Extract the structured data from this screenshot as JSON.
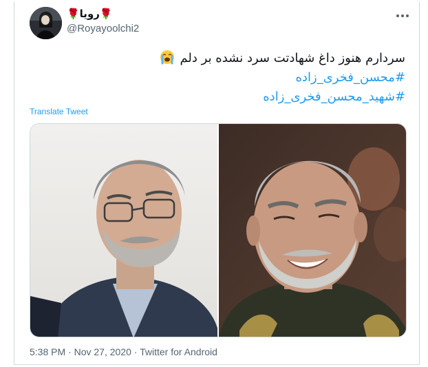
{
  "author": {
    "display_name": "🌹رویا🌹",
    "handle": "@Royayoolchi2"
  },
  "tweet": {
    "line1": "سردارم هنوز داغ شهادتت سرد نشده بر دلم",
    "line1_emoji": "loudly-crying-face-emoji",
    "hashtag1": "#محسن_فخری_زاده",
    "hashtag2": "#شهید_محسن_فخری_زاده"
  },
  "translate_label": "Translate Tweet",
  "media": {
    "photo_left": "photo-elderly-man-glasses",
    "photo_right": "photo-smiling-man-uniform"
  },
  "meta": {
    "time": "5:38 PM",
    "separator": "·",
    "date": "Nov 27, 2020",
    "source": "Twitter for Android"
  },
  "colors": {
    "link": "#1d9bf0",
    "secondary_text": "#536471",
    "border": "#cfd9de"
  }
}
